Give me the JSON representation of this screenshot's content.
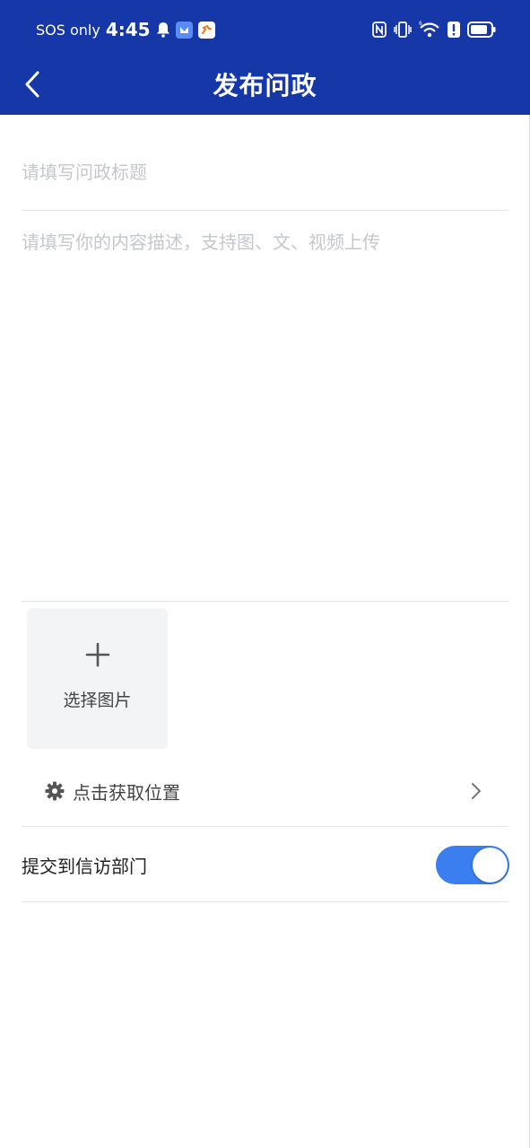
{
  "status_bar": {
    "network": "SOS only",
    "time": "4:45"
  },
  "nav": {
    "title": "发布问政"
  },
  "form": {
    "title_value": "",
    "title_placeholder": "请填写问政标题",
    "description_value": "",
    "description_placeholder": "请填写你的内容描述，支持图、文、视频上传",
    "image_picker_label": "选择图片",
    "location_label": "点击获取位置",
    "submit_to_department_label": "提交到信访部门",
    "submit_to_department_enabled": true
  },
  "colors": {
    "header_bg": "#1537a8",
    "toggle_on": "#3b7ef0",
    "placeholder": "#c4c7cc"
  }
}
